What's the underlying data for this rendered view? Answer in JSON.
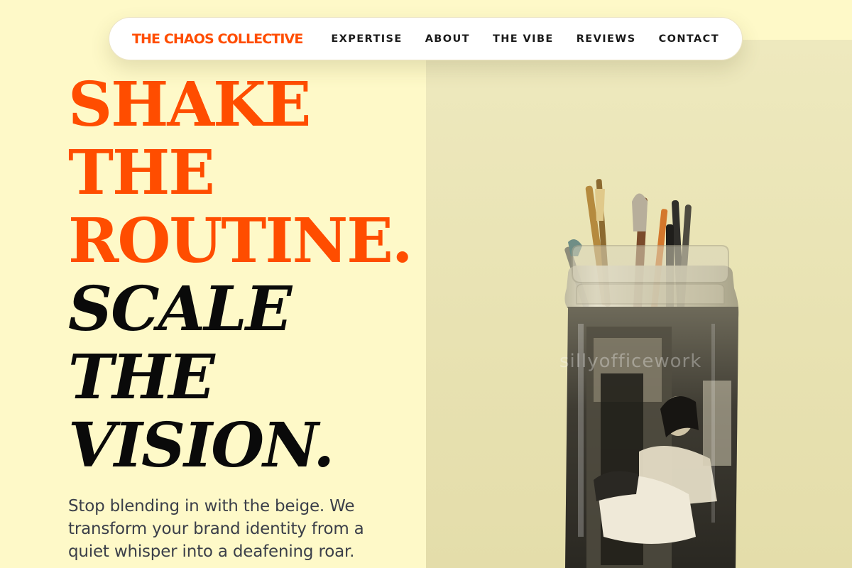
{
  "brand": {
    "name": "THE CHAOS COLLECTIVE"
  },
  "nav": {
    "items": [
      {
        "label": "EXPERTISE"
      },
      {
        "label": "ABOUT"
      },
      {
        "label": "THE VIBE"
      },
      {
        "label": "REVIEWS"
      },
      {
        "label": "CONTACT"
      }
    ]
  },
  "hero": {
    "headline_primary": [
      "SHAKE",
      "THE",
      "ROUTINE."
    ],
    "headline_secondary": [
      "SCALE",
      "THE",
      "VISION."
    ],
    "body": "Stop blending in with the beige. We transform your brand identity from a quiet whisper into a deafening roar.",
    "image": {
      "watermark": "sillyofficework"
    }
  },
  "colors": {
    "accent": "#FF4D00",
    "background": "#FEF9C8",
    "text": "#0A0A0A",
    "body_text": "#3B3F49"
  }
}
